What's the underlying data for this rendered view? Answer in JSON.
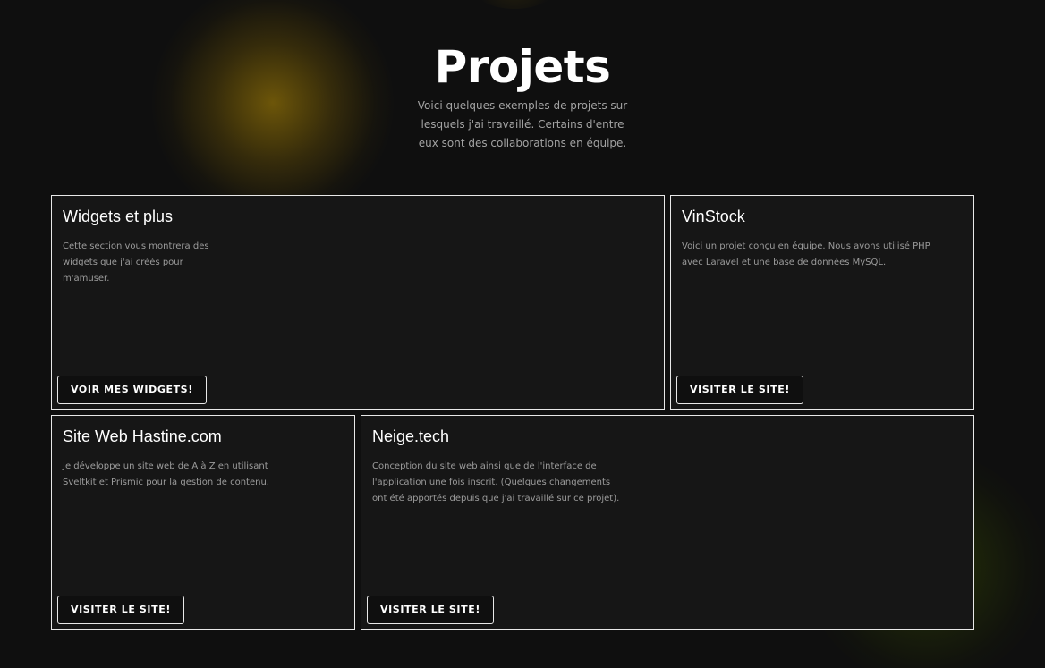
{
  "header": {
    "title": "Projets",
    "subtitle": "Voici quelques exemples de projets sur lesquels j'ai travaillé. Certains d'entre eux sont des collaborations en équipe."
  },
  "projects": [
    {
      "title": "Widgets et plus",
      "description": "Cette section vous montrera des widgets que j'ai créés pour m'amuser.",
      "button_label": "VOIR MES WIDGETS!"
    },
    {
      "title": "VinStock",
      "description": "Voici un projet conçu en équipe. Nous avons utilisé PHP avec Laravel et une base de données MySQL.",
      "button_label": "VISITER LE SITE!"
    },
    {
      "title": "Site Web Hastine.com",
      "description": "Je développe un site web de A à Z en utilisant Sveltkit et Prismic pour la gestion de contenu.",
      "button_label": "VISITER LE SITE!"
    },
    {
      "title": "Neige.tech",
      "description": "Conception du site web ainsi que de l'interface de l'application une fois inscrit. (Quelques changements ont été apportés depuis que j'ai travaillé sur ce projet).",
      "button_label": "VISITER LE SITE!"
    }
  ],
  "colors": {
    "background": "#0f0f0f",
    "card_background": "#161616",
    "border": "#e8e8e8",
    "glow_yellow": "#7d6208",
    "glow_green": "#2c3c06"
  }
}
